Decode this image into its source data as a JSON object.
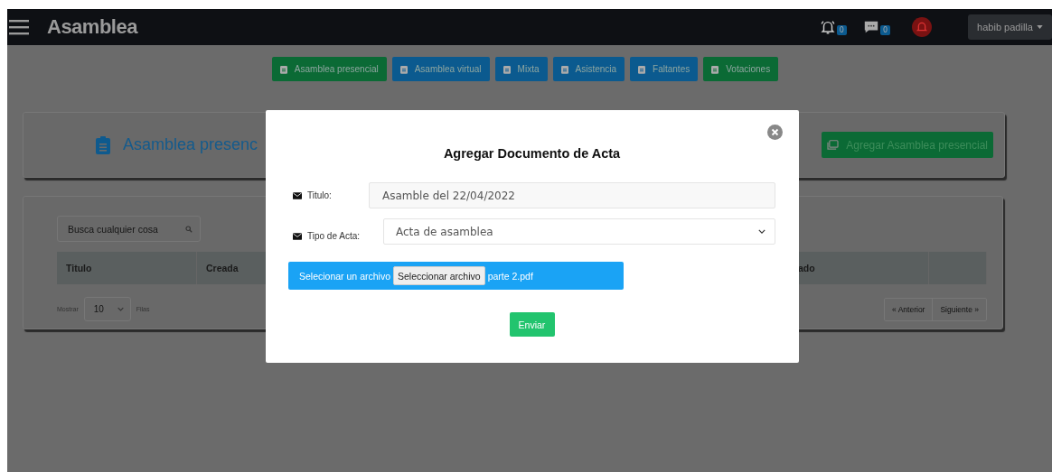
{
  "topbar": {
    "title": "Asamblea",
    "notifications": {
      "count": "0"
    },
    "messages": {
      "count": "0"
    },
    "user": "habib padilla"
  },
  "nav_buttons": [
    {
      "label": "Asamblea presencial",
      "color": "#0b6a35"
    },
    {
      "label": "Asamblea virtual",
      "color": "#0b5a8f"
    },
    {
      "label": "Mixta",
      "color": "#0b5a8f"
    },
    {
      "label": "Asistencia",
      "color": "#0b5a8f"
    },
    {
      "label": "Faltantes",
      "color": "#0b5a8f"
    },
    {
      "label": "Votaciones",
      "color": "#0b6a35"
    }
  ],
  "header_card": {
    "title": "Asamblea presenc",
    "add_button": "Agregar Asamblea presencial"
  },
  "table_card": {
    "search": {
      "placeholder": "Busca cualquier cosa"
    },
    "columns": [
      "Titulo",
      "Creada",
      "ado",
      ""
    ],
    "length": {
      "before": "Mostrar",
      "value": "10",
      "after": "Filas"
    },
    "pagination": {
      "previous": "« Anterior",
      "next": "Siguiente »"
    }
  },
  "modal": {
    "title": "Agregar Documento de Acta",
    "fields": [
      {
        "kind": "text",
        "label": "Titulo:",
        "value": "Asamble del 22/04/2022"
      },
      {
        "kind": "select",
        "label": "Tipo de Acta:",
        "value": "Acta de asamblea"
      }
    ],
    "file": {
      "label": "Selecionar un archivo",
      "button": "Seleccionar archivo",
      "filename": "parte 2.pdf"
    },
    "submit": "Enviar"
  }
}
